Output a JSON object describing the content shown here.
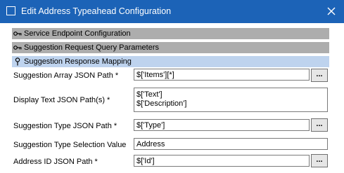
{
  "window": {
    "title": "Edit Address Typeahead Configuration",
    "icons": {
      "app": "window-icon",
      "close": "close-icon"
    }
  },
  "sections": [
    {
      "label": "Service Endpoint Configuration",
      "icon": "key-icon",
      "expanded": false
    },
    {
      "label": "Suggestion Request Query Parameters",
      "icon": "key-icon",
      "expanded": false
    },
    {
      "label": "Suggestion Response Mapping",
      "icon": "pin-icon",
      "expanded": true
    }
  ],
  "fields": {
    "suggestion_array": {
      "label": "Suggestion Array JSON Path *",
      "value": "$['Items'][*]",
      "button": "..."
    },
    "display_text": {
      "label": "Display Text JSON Path(s) *",
      "lines": [
        "$['Text']",
        "$['Description']"
      ]
    },
    "suggestion_type": {
      "label": "Suggestion Type JSON Path *",
      "value": "$['Type']",
      "button": "..."
    },
    "type_selection": {
      "label": "Suggestion Type Selection Value",
      "value": "Address"
    },
    "address_id": {
      "label": "Address ID JSON Path *",
      "value": "$['Id']",
      "button": "..."
    }
  },
  "colors": {
    "titlebar": "#1c63b7",
    "section_collapsed": "#adadad",
    "section_expanded": "#bed3ee"
  }
}
